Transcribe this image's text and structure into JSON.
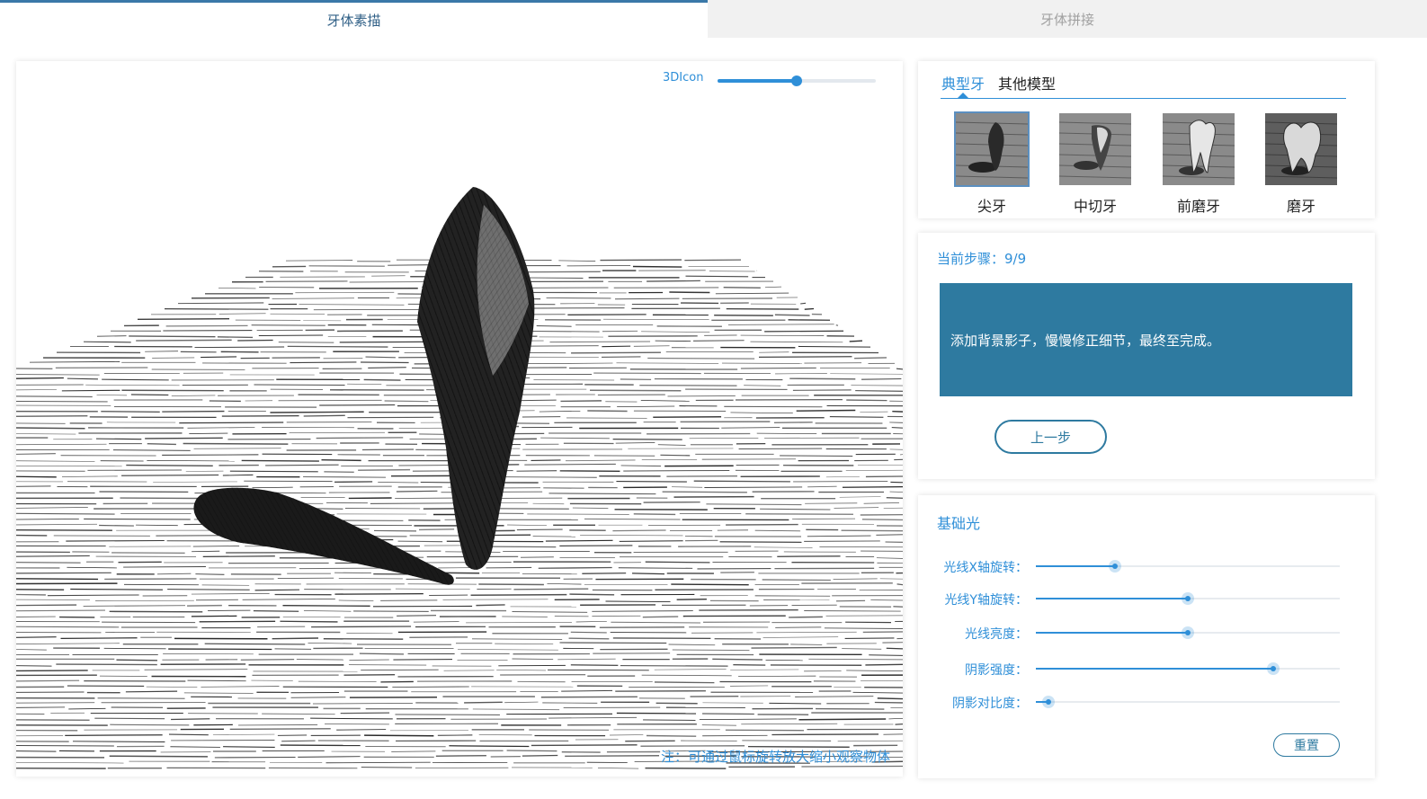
{
  "tabs": {
    "sketch": "牙体素描",
    "splice": "牙体拼接"
  },
  "viewport": {
    "slider_label": "3DIcon",
    "slider_value": 0.5,
    "note": "注：可通过鼠标旋转放大缩小观察物体"
  },
  "model_tabs": {
    "typical": "典型牙",
    "other": "其他模型"
  },
  "teeth": [
    {
      "name": "尖牙",
      "selected": true,
      "icon": "canine-tooth-icon"
    },
    {
      "name": "中切牙",
      "selected": false,
      "icon": "central-incisor-icon"
    },
    {
      "name": "前磨牙",
      "selected": false,
      "icon": "premolar-icon"
    },
    {
      "name": "磨牙",
      "selected": false,
      "icon": "molar-icon"
    }
  ],
  "steps": {
    "label": "当前步骤：9/9",
    "description": "添加背景影子，慢慢修正细节，最终至完成。",
    "prev_button": "上一步"
  },
  "lighting": {
    "title": "基础光",
    "sliders": [
      {
        "label": "光线X轴旋转：",
        "value": 0.26
      },
      {
        "label": "光线Y轴旋转：",
        "value": 0.5
      },
      {
        "label": "光线亮度：",
        "value": 0.5
      },
      {
        "label": "阴影强度：",
        "value": 0.78
      },
      {
        "label": "阴影对比度：",
        "value": 0.04
      }
    ],
    "reset_button": "重置"
  },
  "colors": {
    "accent": "#2f8fd8",
    "step_box": "#2e7aa0"
  }
}
